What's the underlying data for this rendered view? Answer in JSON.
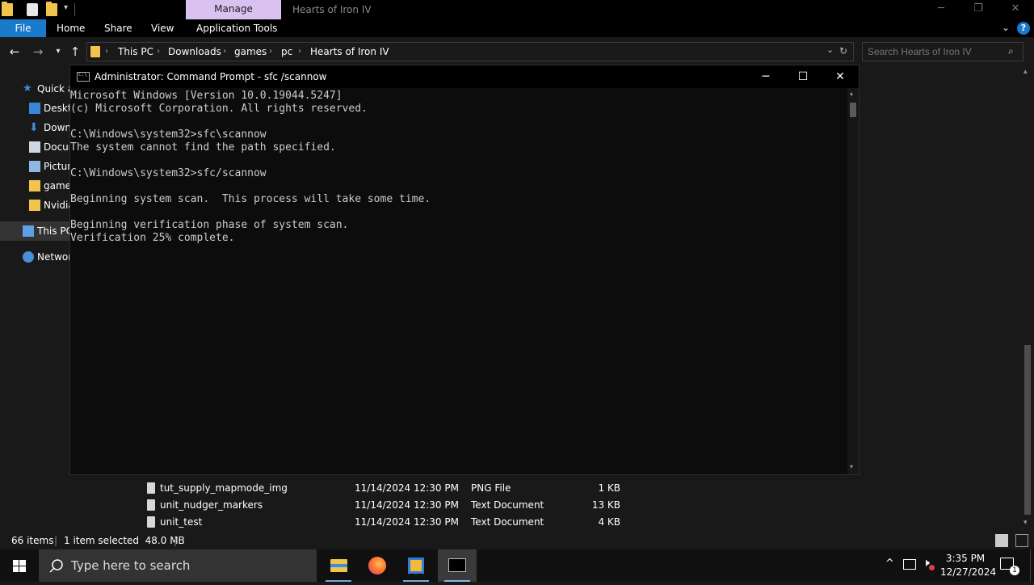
{
  "explorer": {
    "manage_tab": "Manage",
    "window_title": "Hearts of Iron IV",
    "ribbon_tabs": [
      "File",
      "Home",
      "Share",
      "View",
      "Application Tools"
    ],
    "breadcrumbs": [
      "This PC",
      "Downloads",
      "games",
      "pc",
      "Hearts of Iron IV"
    ],
    "search_placeholder": "Search Hearts of Iron IV",
    "nav_items": [
      "Quick a",
      "Deskto",
      "Down",
      "Docur",
      "Pictur",
      "games",
      "Nvidia",
      "This PC",
      "Networ"
    ],
    "files": [
      {
        "name": "tut_supply_mapmode_img",
        "date": "11/14/2024 12:30 PM",
        "type": "PNG File",
        "size": "1 KB"
      },
      {
        "name": "unit_nudger_markers",
        "date": "11/14/2024 12:30 PM",
        "type": "Text Document",
        "size": "13 KB"
      },
      {
        "name": "unit_test",
        "date": "11/14/2024 12:30 PM",
        "type": "Text Document",
        "size": "4 KB"
      }
    ],
    "status": {
      "items": "66 items",
      "selected": "1 item selected  48.0 MB"
    }
  },
  "cmd": {
    "title": "Administrator: Command Prompt - sfc /scannow",
    "lines": [
      "Microsoft Windows [Version 10.0.19044.5247]",
      "(c) Microsoft Corporation. All rights reserved.",
      "",
      "C:\\Windows\\system32>sfc\\scannow",
      "The system cannot find the path specified.",
      "",
      "C:\\Windows\\system32>sfc/scannow",
      "",
      "Beginning system scan.  This process will take some time.",
      "",
      "Beginning verification phase of system scan.",
      "Verification 25% complete."
    ]
  },
  "taskbar": {
    "search_placeholder": "Type here to search",
    "time": "3:35 PM",
    "date": "12/27/2024",
    "notification_count": "1"
  },
  "colors": {
    "accent_blue": "#1979ca",
    "manage_tab": "#d9c2f0",
    "console_text": "#cccccc"
  }
}
